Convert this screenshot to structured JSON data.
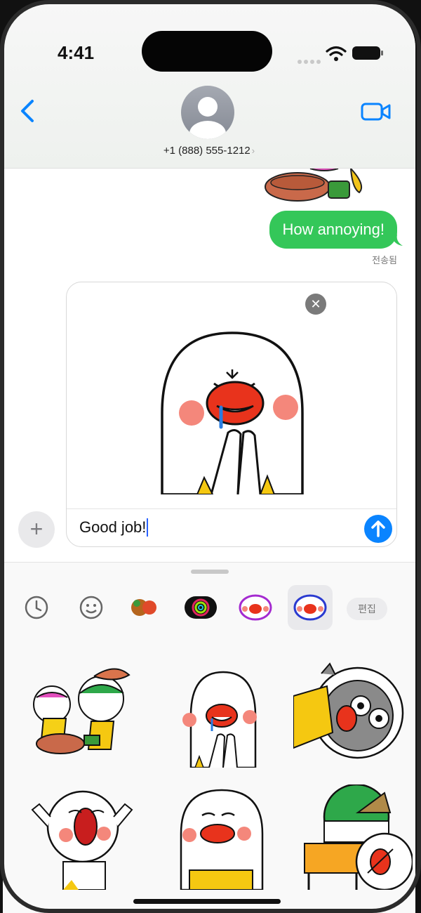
{
  "status_bar": {
    "time": "4:41"
  },
  "header": {
    "back_icon": "chevron-left-icon",
    "contact_number": "+1 (888) 555-1212",
    "video_icon": "video-camera-icon",
    "accent": "#0a84ff"
  },
  "messages": {
    "sent_text": "How annoying!",
    "sent_color": "#34c759",
    "delivered_label": "전송됨"
  },
  "compose": {
    "text": "Good job!",
    "remove_icon": "close-icon",
    "send_icon": "arrow-up-icon",
    "plus_icon": "plus-icon"
  },
  "sticker_drawer": {
    "tabs": [
      {
        "icon": "recent-clock-icon"
      },
      {
        "icon": "emoji-face-icon"
      },
      {
        "icon": "sticker-pack-icon"
      },
      {
        "icon": "activity-rings-icon"
      },
      {
        "icon": "sticker-pack-icon"
      },
      {
        "icon": "sticker-pack-icon",
        "selected": true
      }
    ],
    "edit_label": "편집",
    "stickers": [
      "eating-sticker",
      "praying-sticker",
      "grey-character-sticker",
      "crying-sticker",
      "smirking-sticker",
      "studying-sticker"
    ]
  }
}
